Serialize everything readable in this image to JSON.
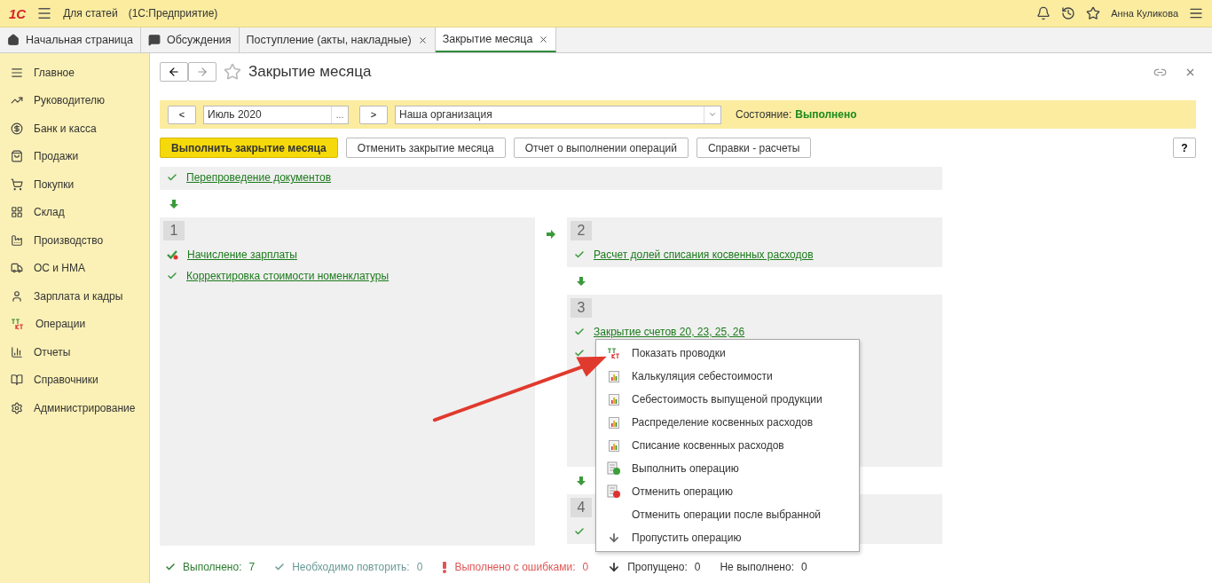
{
  "window": {
    "logo": "1С",
    "title": "Для статей",
    "subtitle": "(1С:Предприятие)",
    "user": "Анна Куликова"
  },
  "tabs": [
    {
      "label": "Начальная страница",
      "closable": false,
      "selected": false
    },
    {
      "label": "Обсуждения",
      "closable": false,
      "selected": false
    },
    {
      "label": "Поступление (акты, накладные)",
      "closable": true,
      "selected": false
    },
    {
      "label": "Закрытие месяца",
      "closable": true,
      "selected": true
    }
  ],
  "sidebar": {
    "items": [
      {
        "label": "Главное"
      },
      {
        "label": "Руководителю"
      },
      {
        "label": "Банк и касса"
      },
      {
        "label": "Продажи"
      },
      {
        "label": "Покупки"
      },
      {
        "label": "Склад"
      },
      {
        "label": "Производство"
      },
      {
        "label": "ОС и НМА"
      },
      {
        "label": "Зарплата и кадры"
      },
      {
        "label": "Операции"
      },
      {
        "label": "Отчеты"
      },
      {
        "label": "Справочники"
      },
      {
        "label": "Администрирование"
      }
    ]
  },
  "form": {
    "title": "Закрытие месяца",
    "favorite": false,
    "period": {
      "prev": "<",
      "value": "Июль 2020",
      "pick": "...",
      "next": ">"
    },
    "organization": {
      "value": "Наша организация"
    },
    "state": {
      "label": "Состояние:",
      "value": "Выполнено"
    },
    "buttons": [
      {
        "label": "Выполнить закрытие месяца",
        "primary": true
      },
      {
        "label": "Отменить закрытие месяца",
        "primary": false
      },
      {
        "label": "Отчет о выполнении операций",
        "primary": false
      },
      {
        "label": "Справки - расчеты",
        "primary": false
      }
    ],
    "help": "?",
    "pre_stage": {
      "items": [
        {
          "label": "Перепроведение документов",
          "kind": "plain"
        }
      ]
    },
    "stages": [
      {
        "number": "1",
        "items": [
          {
            "label": "Начисление зарплаты",
            "kind": "flagged"
          },
          {
            "label": "Корректировка стоимости номенклатуры",
            "kind": "plain"
          }
        ]
      },
      {
        "number": "2",
        "items": [
          {
            "label": "Расчет долей списания косвенных расходов",
            "kind": "plain"
          }
        ]
      },
      {
        "number": "3",
        "items": [
          {
            "label": "Закрытие счетов 20, 23, 25, 26",
            "kind": "plain"
          },
          {
            "kind": "plain"
          }
        ]
      },
      {
        "number": "4",
        "items": [
          {
            "kind": "plain"
          }
        ]
      }
    ]
  },
  "context_menu": {
    "items": [
      {
        "label": "Показать проводки"
      },
      {
        "label": "Калькуляция себестоимости"
      },
      {
        "label": "Себестоимость выпущеной продукции"
      },
      {
        "label": "Распределение косвенных расходов"
      },
      {
        "label": "Списание косвенных расходов"
      },
      {
        "label": "Выполнить операцию"
      },
      {
        "label": "Отменить операцию"
      },
      {
        "label": "Отменить операции после выбранной"
      },
      {
        "label": "Пропустить операцию"
      }
    ]
  },
  "status_bar": [
    {
      "label": "Выполнено:",
      "count": "7",
      "color": "#2e7d32"
    },
    {
      "label": "Необходимо повторить:",
      "count": "0",
      "color": "#6a9a96"
    },
    {
      "label": "Выполнено с ошибками:",
      "count": "0",
      "color": "#e05555"
    },
    {
      "label": "Пропущено:",
      "count": "0",
      "color": "#333333"
    },
    {
      "label": "Не выполнено:",
      "count": "0",
      "color": "#333333"
    }
  ]
}
